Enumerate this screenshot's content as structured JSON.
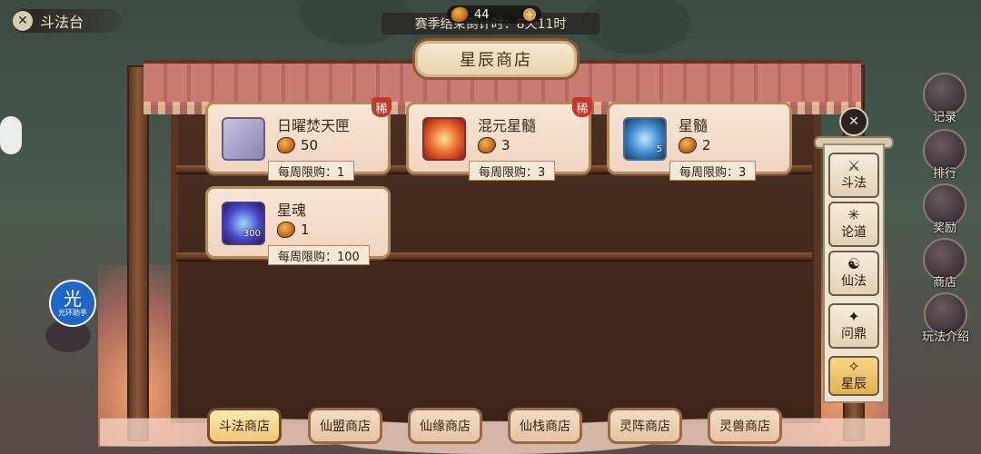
{
  "header": {
    "title": "斗法台",
    "currency_amount": "44",
    "countdown": "赛季结束倒计时：8天11时"
  },
  "shop": {
    "title": "星辰商店",
    "items": [
      {
        "name": "日曜焚天匣",
        "price": "50",
        "limit": "每周限购：1",
        "rare": "稀",
        "qty": ""
      },
      {
        "name": "混元星髓",
        "price": "3",
        "limit": "每周限购：3",
        "rare": "稀",
        "qty": ""
      },
      {
        "name": "星髓",
        "price": "2",
        "limit": "每周限购：3",
        "rare": "",
        "qty": "5"
      },
      {
        "name": "星魂",
        "price": "1",
        "limit": "每周限购：100",
        "rare": "",
        "qty": "300"
      }
    ],
    "tabs": [
      "斗法商店",
      "仙盟商店",
      "仙缘商店",
      "仙栈商店",
      "灵阵商店",
      "灵兽商店"
    ]
  },
  "side_panel": {
    "buttons": [
      {
        "label": "斗法",
        "glyph": "⚔"
      },
      {
        "label": "论道",
        "glyph": "✳"
      },
      {
        "label": "仙法",
        "glyph": "☯"
      },
      {
        "label": "问鼎",
        "glyph": "✦"
      },
      {
        "label": "星辰",
        "glyph": "✧"
      }
    ]
  },
  "right_menu": [
    "记录",
    "排行",
    "奖励",
    "商店",
    "玩法介绍"
  ],
  "helper": {
    "glyph": "光",
    "label": "光环助手"
  },
  "colors": {
    "rare_badge": "#c23a2a",
    "card_bg": "#f7e6d4",
    "frame": "#8a5a38"
  }
}
